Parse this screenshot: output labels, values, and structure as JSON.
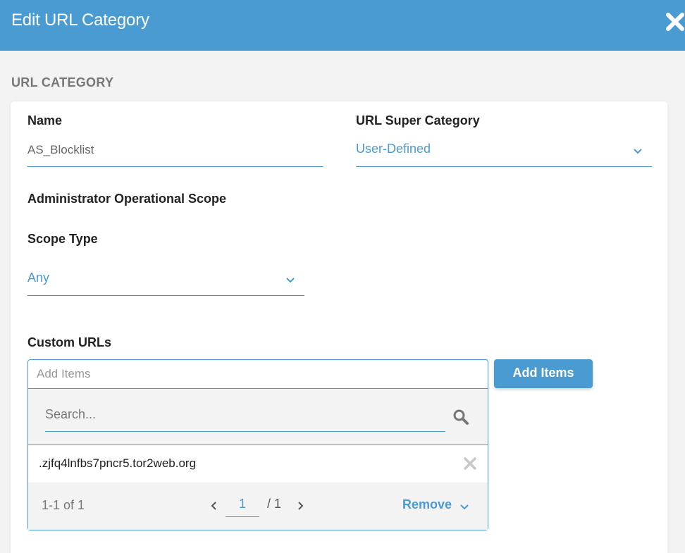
{
  "header": {
    "title": "Edit URL Category"
  },
  "section": {
    "label": "URL CATEGORY"
  },
  "form": {
    "name": {
      "label": "Name",
      "value": "AS_Blocklist"
    },
    "super_category": {
      "label": "URL Super Category",
      "value": "User-Defined"
    },
    "admin_scope": {
      "label": "Administrator Operational Scope"
    },
    "scope_type": {
      "label": "Scope Type",
      "value": "Any"
    },
    "custom_urls": {
      "label": "Custom URLs",
      "add_placeholder": "Add Items",
      "add_button_label": "Add Items",
      "search_placeholder": "Search...",
      "items": [
        ".zjfq4lnfbs7pncr5.tor2web.org"
      ],
      "count_text": "1-1 of 1",
      "current_page": "1",
      "total_pages": "/ 1",
      "remove_label": "Remove"
    }
  },
  "colors": {
    "accent": "#4a9bd1",
    "muted": "#777777"
  },
  "icons": {
    "close": "close-icon",
    "chevron": "chevron-down-icon",
    "search": "search-icon",
    "remove_item": "x-icon"
  }
}
